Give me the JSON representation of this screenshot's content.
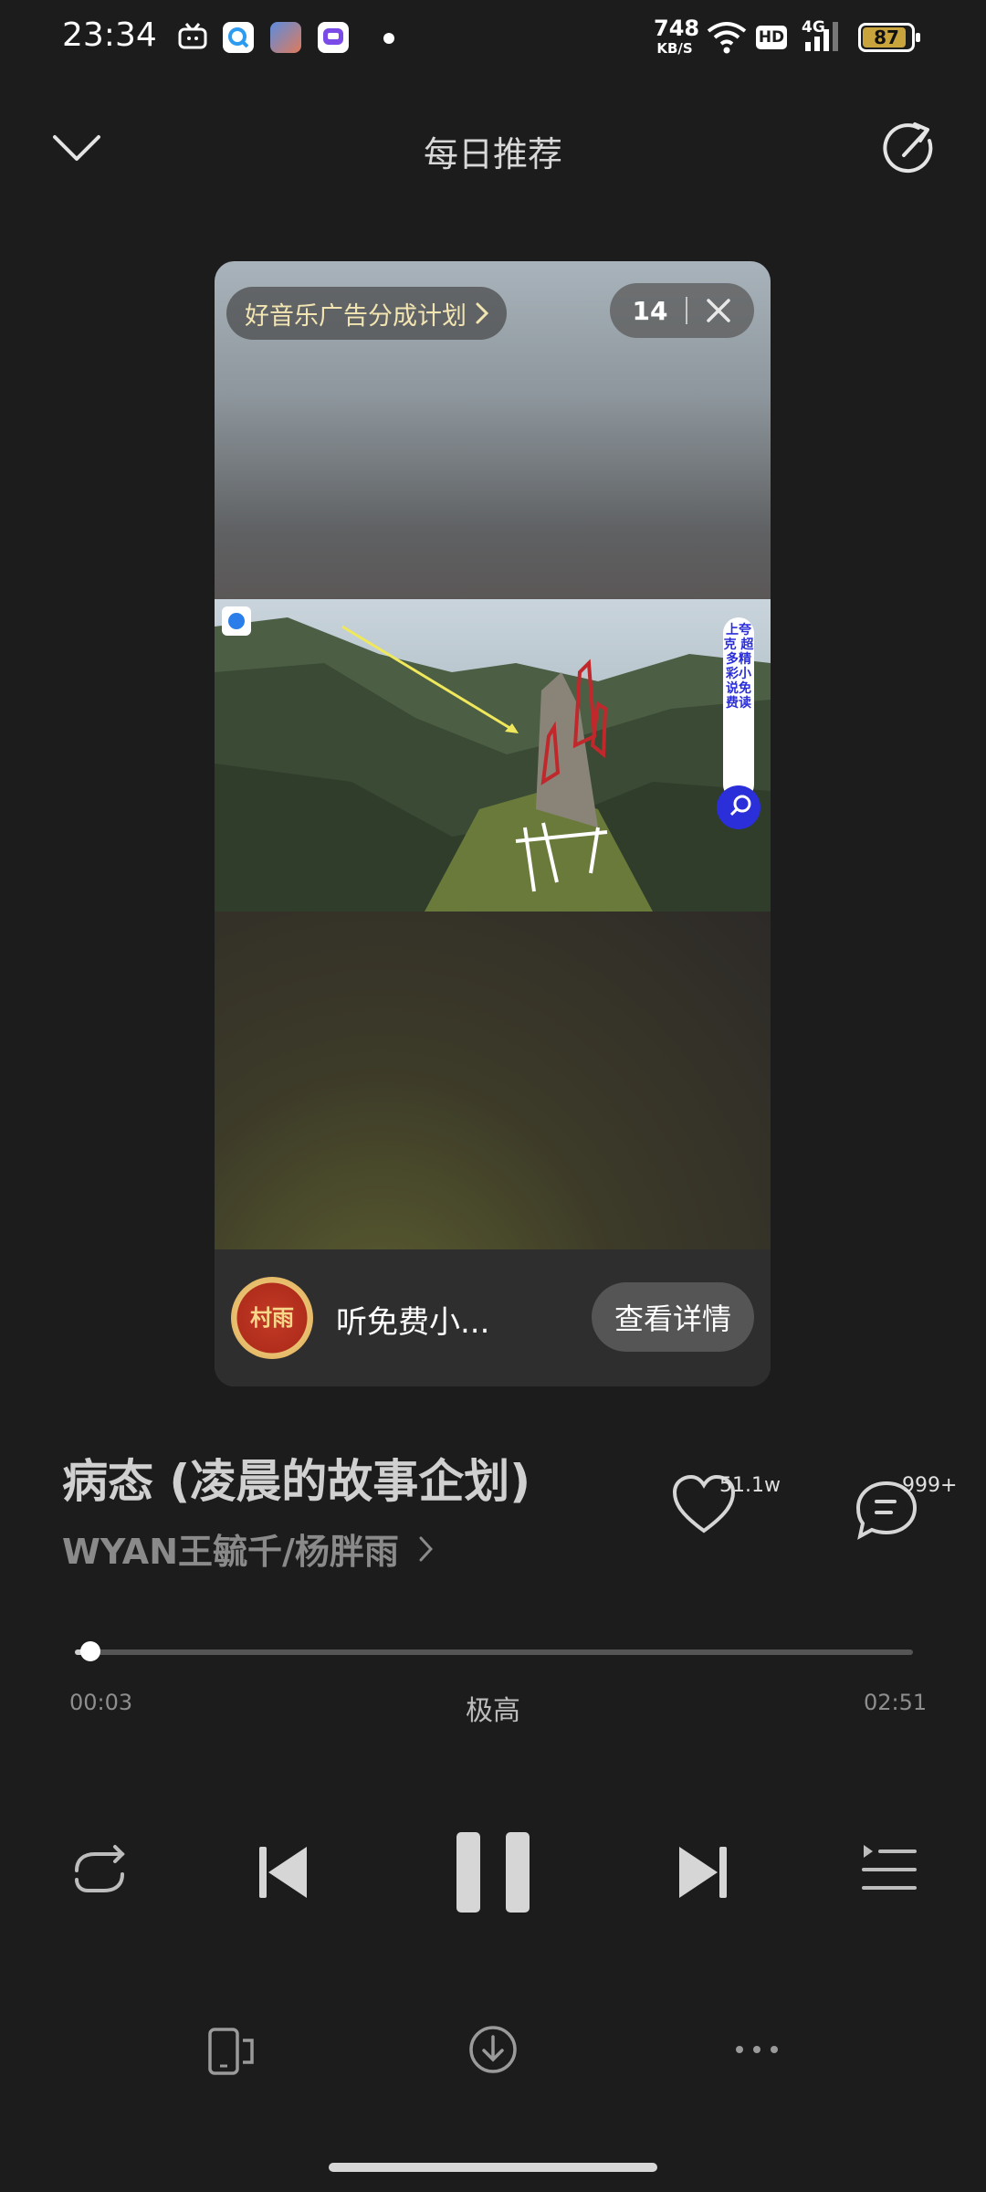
{
  "status_bar": {
    "time": "23:34",
    "net_speed_value": "748",
    "net_speed_unit": "KB/S",
    "hd_label": "HD",
    "network_label": "4G",
    "battery": "87",
    "icons": [
      "tv-icon",
      "search-app-icon",
      "game-app-icon",
      "chat-app-icon",
      "dot-icon",
      "wifi-icon",
      "signal-icon",
      "battery-icon"
    ]
  },
  "header": {
    "title": "每日推荐",
    "icons": [
      "chevron-down-icon",
      "share-icon"
    ]
  },
  "ad": {
    "tag_label": "好音乐广告分成计划",
    "countdown": "14",
    "vertical_banner": "上夸克 超多精彩小说免费读",
    "text": "听免费小...",
    "detail_button": "查看详情",
    "logo_text": "村雨"
  },
  "song": {
    "title": "病态 (凌晨的故事企划)",
    "artist": "WYAN王毓千/杨胖雨",
    "likes": "51.1w",
    "comments": "999+"
  },
  "player": {
    "current_time": "00:03",
    "total_time": "02:51",
    "quality": "极高",
    "progress_fraction": 0.018
  },
  "colors": {
    "background": "#1c1c1c",
    "ad_tag_text": "#f2e5b2",
    "battery": "#c9a43c"
  }
}
